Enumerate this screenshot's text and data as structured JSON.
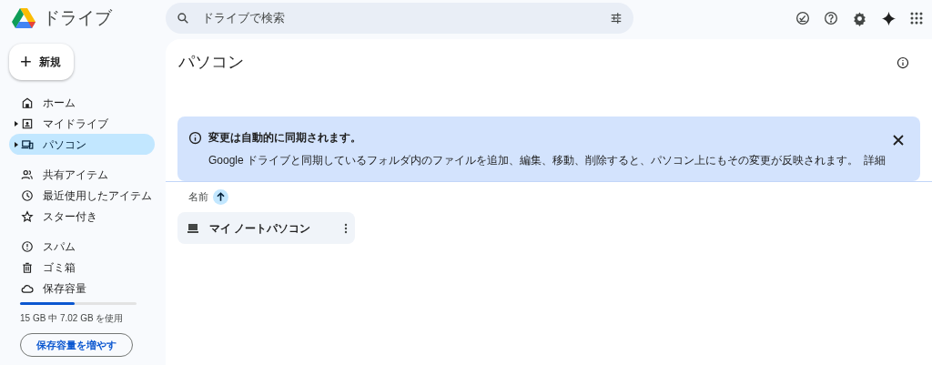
{
  "app": {
    "title": "ドライブ"
  },
  "search": {
    "placeholder": "ドライブで検索"
  },
  "new_button": {
    "label": "新規",
    "icon": "+"
  },
  "sidebar": {
    "groups": [
      [
        {
          "kind": "home",
          "label": "ホーム",
          "expandable": false,
          "selected": false
        },
        {
          "kind": "drive",
          "label": "マイドライブ",
          "expandable": true,
          "selected": false
        },
        {
          "kind": "computer",
          "label": "パソコン",
          "expandable": true,
          "selected": true
        }
      ],
      [
        {
          "kind": "shared",
          "label": "共有アイテム",
          "expandable": false,
          "selected": false
        },
        {
          "kind": "recent",
          "label": "最近使用したアイテム",
          "expandable": false,
          "selected": false
        },
        {
          "kind": "star",
          "label": "スター付き",
          "expandable": false,
          "selected": false
        }
      ],
      [
        {
          "kind": "spam",
          "label": "スパム",
          "expandable": false,
          "selected": false
        },
        {
          "kind": "trash",
          "label": "ゴミ箱",
          "expandable": false,
          "selected": false
        },
        {
          "kind": "cloud",
          "label": "保存容量",
          "expandable": false,
          "selected": false
        }
      ]
    ]
  },
  "storage": {
    "level": 0.468,
    "usage": "15 GB 中 7.02 GB を使用",
    "button": "保存容量を増やす"
  },
  "page": {
    "title": "パソコン"
  },
  "banner": {
    "title": "変更は自動的に同期されます。",
    "body": "Google ドライブと同期しているフォルダ内のファイルを追加、編集、移動、削除すると、パソコン上にもその変更が反映されます。",
    "link": "詳細"
  },
  "sort": {
    "label": "名前"
  },
  "items": [
    {
      "name": "マイ ノートパソコン"
    }
  ]
}
